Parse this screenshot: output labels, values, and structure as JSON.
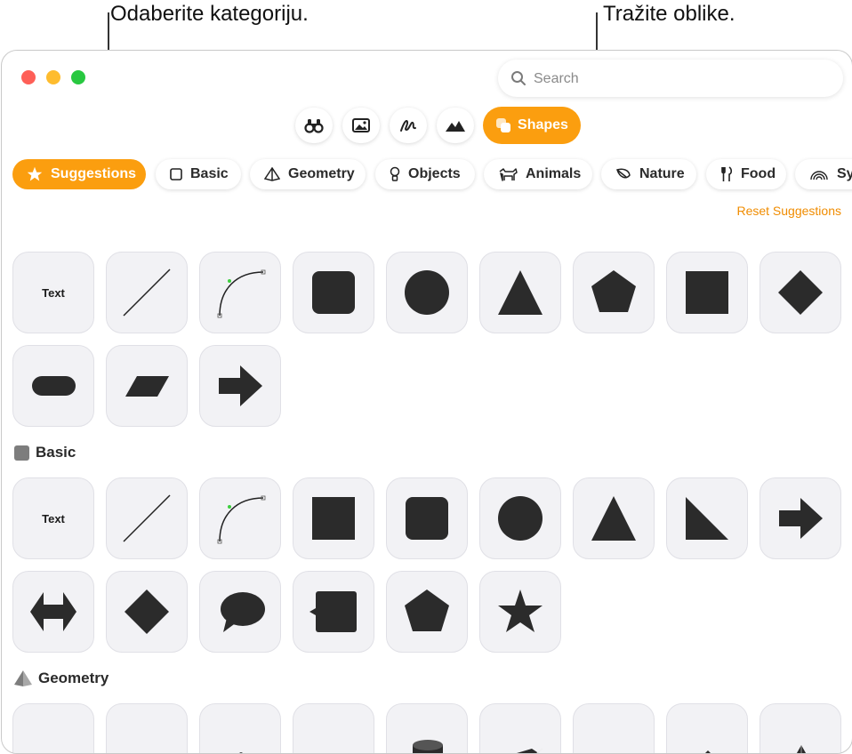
{
  "callouts": {
    "category": "Odaberite kategoriju.",
    "search": "Tražite oblike."
  },
  "window": {
    "traffic_lights": [
      "#fe5f57",
      "#febc2e",
      "#28c840"
    ],
    "accent": "#fb9e0f"
  },
  "search": {
    "placeholder": "Search",
    "icon": "magnifier-icon"
  },
  "toolbar": {
    "buttons": [
      {
        "icon": "binoculars-icon"
      },
      {
        "icon": "photo-icon"
      },
      {
        "icon": "scribble-icon"
      },
      {
        "icon": "mountains-icon"
      }
    ],
    "shapes_label": "Shapes",
    "shapes_icon": "shapes-icon"
  },
  "categories": [
    {
      "label": "Suggestions",
      "icon": "star-icon",
      "active": true
    },
    {
      "label": "Basic",
      "icon": "square-icon"
    },
    {
      "label": "Geometry",
      "icon": "pyramid-icon"
    },
    {
      "label": "Objects",
      "icon": "lightbulb-icon"
    },
    {
      "label": "Animals",
      "icon": "dog-icon"
    },
    {
      "label": "Nature",
      "icon": "leaf-icon"
    },
    {
      "label": "Food",
      "icon": "fork-knife-icon"
    },
    {
      "label": "Sy",
      "icon": "rainbow-icon"
    }
  ],
  "reset_suggestions": "Reset Suggestions",
  "suggestions_shapes": [
    "text",
    "line",
    "curve",
    "rounded-square",
    "circle",
    "triangle",
    "pentagon",
    "square",
    "diamond",
    "pill",
    "parallelogram",
    "arrow-right"
  ],
  "sections": {
    "basic": {
      "title": "Basic",
      "icon": "square-icon",
      "shapes": [
        "text",
        "line",
        "curve",
        "square",
        "rounded-square",
        "circle",
        "triangle",
        "right-triangle",
        "arrow-right",
        "double-arrow",
        "diamond",
        "speech-bubble",
        "callout-square",
        "pentagon",
        "star"
      ]
    },
    "geometry": {
      "title": "Geometry",
      "icon": "pyramid-icon"
    }
  },
  "tile_text": "Text"
}
